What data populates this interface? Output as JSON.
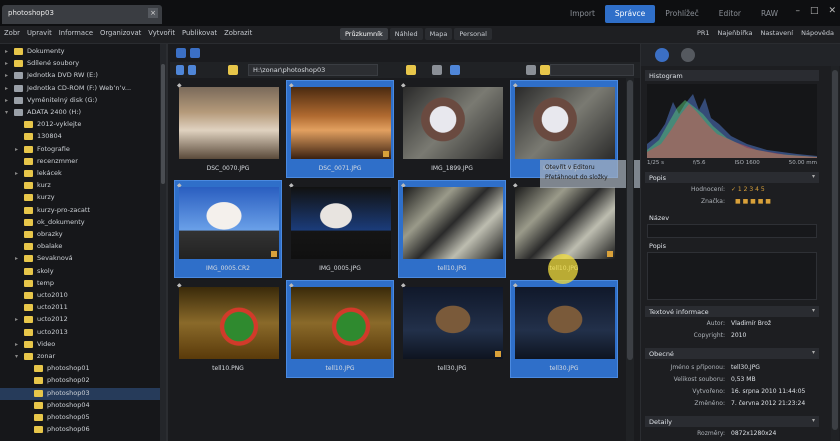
{
  "titlebar": {
    "doc_tab": "photoshop03",
    "modes": [
      "Import",
      "Správce",
      "Prohlížeč",
      "Editor",
      "RAW"
    ],
    "active_mode_index": 1
  },
  "menubar": {
    "items": [
      "Zobr",
      "Upravit",
      "Informace",
      "Organizovat",
      "Vytvořit",
      "Publikovat",
      "Zobrazit"
    ],
    "view_buttons": [
      "Průzkumník",
      "Náhled",
      "Mapa",
      "Personal"
    ],
    "right_items": [
      "PR1",
      "Najeňbířka",
      "Nastavení",
      "Nápověda"
    ]
  },
  "tree": {
    "items": [
      {
        "label": "Dokumenty",
        "indent": 1,
        "type": "folder",
        "arrow": "▸"
      },
      {
        "label": "Sdílené soubory",
        "indent": 1,
        "type": "folder",
        "arrow": "▸"
      },
      {
        "label": "Jednotka DVD RW (E:)",
        "indent": 1,
        "type": "drive",
        "arrow": "▸"
      },
      {
        "label": "Jednotka CD-ROM (F:) Web’n’v...",
        "indent": 1,
        "type": "drive",
        "arrow": "▸"
      },
      {
        "label": "Vyměnitelný disk (G:)",
        "indent": 1,
        "type": "drive",
        "arrow": "▸"
      },
      {
        "label": "ADATA 2400 (H:)",
        "indent": 1,
        "type": "drive",
        "arrow": "▾"
      },
      {
        "label": "2012-vyklejte",
        "indent": 2,
        "type": "folder",
        "arrow": ""
      },
      {
        "label": "130804",
        "indent": 2,
        "type": "folder",
        "arrow": ""
      },
      {
        "label": "Fotografie",
        "indent": 2,
        "type": "folder",
        "arrow": "▸"
      },
      {
        "label": "recenzmmer",
        "indent": 2,
        "type": "folder",
        "arrow": ""
      },
      {
        "label": "lekácek",
        "indent": 2,
        "type": "folder",
        "arrow": "▸"
      },
      {
        "label": "kurz",
        "indent": 2,
        "type": "folder",
        "arrow": ""
      },
      {
        "label": "kurzy",
        "indent": 2,
        "type": "folder",
        "arrow": ""
      },
      {
        "label": "kurzy-pro-zacatt",
        "indent": 2,
        "type": "folder",
        "arrow": ""
      },
      {
        "label": "ok_dokumenty",
        "indent": 2,
        "type": "folder",
        "arrow": ""
      },
      {
        "label": "obrazky",
        "indent": 2,
        "type": "folder",
        "arrow": ""
      },
      {
        "label": "obalake",
        "indent": 2,
        "type": "folder",
        "arrow": ""
      },
      {
        "label": "Sevaknová",
        "indent": 2,
        "type": "folder",
        "arrow": "▸"
      },
      {
        "label": "skoly",
        "indent": 2,
        "type": "folder",
        "arrow": ""
      },
      {
        "label": "temp",
        "indent": 2,
        "type": "folder",
        "arrow": ""
      },
      {
        "label": "ucto2010",
        "indent": 2,
        "type": "folder",
        "arrow": ""
      },
      {
        "label": "ucto2011",
        "indent": 2,
        "type": "folder",
        "arrow": ""
      },
      {
        "label": "ucto2012",
        "indent": 2,
        "type": "folder",
        "arrow": "▸"
      },
      {
        "label": "ucto2013",
        "indent": 2,
        "type": "folder",
        "arrow": ""
      },
      {
        "label": "Video",
        "indent": 2,
        "type": "folder",
        "arrow": "▸"
      },
      {
        "label": "zonar",
        "indent": 2,
        "type": "folder",
        "arrow": "▾"
      },
      {
        "label": "photoshop01",
        "indent": 3,
        "type": "folder",
        "arrow": ""
      },
      {
        "label": "photoshop02",
        "indent": 3,
        "type": "folder",
        "arrow": ""
      },
      {
        "label": "photoshop03",
        "indent": 3,
        "type": "folder",
        "arrow": "",
        "selected": true
      },
      {
        "label": "photoshop04",
        "indent": 3,
        "type": "folder",
        "arrow": ""
      },
      {
        "label": "photoshop05",
        "indent": 3,
        "type": "folder",
        "arrow": ""
      },
      {
        "label": "photoshop06",
        "indent": 3,
        "type": "folder",
        "arrow": ""
      }
    ]
  },
  "main": {
    "path": "H:\\zonar\\photoshop03",
    "thumbnails": [
      {
        "name": "DSC_0070.JPG",
        "selected": false,
        "kind": "hall"
      },
      {
        "name": "DSC_0071.JPG",
        "selected": true,
        "kind": "hall-warm"
      },
      {
        "name": "IMG_1899.JPG",
        "selected": false,
        "kind": "duck"
      },
      {
        "name": "IMG_1899.JPG",
        "selected": true,
        "kind": "duck"
      },
      {
        "name": "IMG_0005.CR2",
        "selected": true,
        "kind": "bride"
      },
      {
        "name": "IMG_0005.JPG",
        "selected": false,
        "kind": "bride-dark"
      },
      {
        "name": "tell10.JPG",
        "selected": true,
        "kind": "engine"
      },
      {
        "name": "tell10.JPG",
        "selected": false,
        "kind": "engine"
      },
      {
        "name": "tell10.PNG",
        "selected": false,
        "kind": "parrot"
      },
      {
        "name": "tell10.JPG",
        "selected": true,
        "kind": "parrot"
      },
      {
        "name": "tell30.JPG",
        "selected": false,
        "kind": "statue"
      },
      {
        "name": "tell30.JPG",
        "selected": true,
        "kind": "statue"
      }
    ],
    "tooltip_line1": "Otevřít v Editoru",
    "tooltip_line2": "Přetáhnout do složky"
  },
  "right": {
    "histogram_label": "Histogram",
    "histo_labels": [
      "1/25 s",
      "f/5.6",
      "ISO 1600",
      "50.00 mm"
    ],
    "section_popis": "Popis",
    "props_top": [
      {
        "k": "Hodnocení:",
        "v": "✓ 1 2 3 4 5"
      },
      {
        "k": "Značka:",
        "v": ""
      }
    ],
    "section_nazev": "Název",
    "section_popis2": "Popis",
    "section_textove": "Textové informace",
    "props_text": [
      {
        "k": "Autor:",
        "v": "Vladimír Brož"
      },
      {
        "k": "Copyright:",
        "v": "2010"
      }
    ],
    "section_obecne": "Obecné",
    "props_general": [
      {
        "k": "Jméno s příponou:",
        "v": "tell30.JPG"
      },
      {
        "k": "Velikost souboru:",
        "v": "0,53 MB"
      },
      {
        "k": "Vytvořeno:",
        "v": "16. srpna 2010 11:44:05"
      },
      {
        "k": "Změněno:",
        "v": "7. června 2012 21:23:24"
      }
    ],
    "section_detaily": "Detaily",
    "props_detail": [
      {
        "k": "Rozměry:",
        "v": "0872x1280x24"
      }
    ]
  },
  "colors": {
    "accent": "#2f6fc9",
    "folder": "#e7c64a"
  }
}
